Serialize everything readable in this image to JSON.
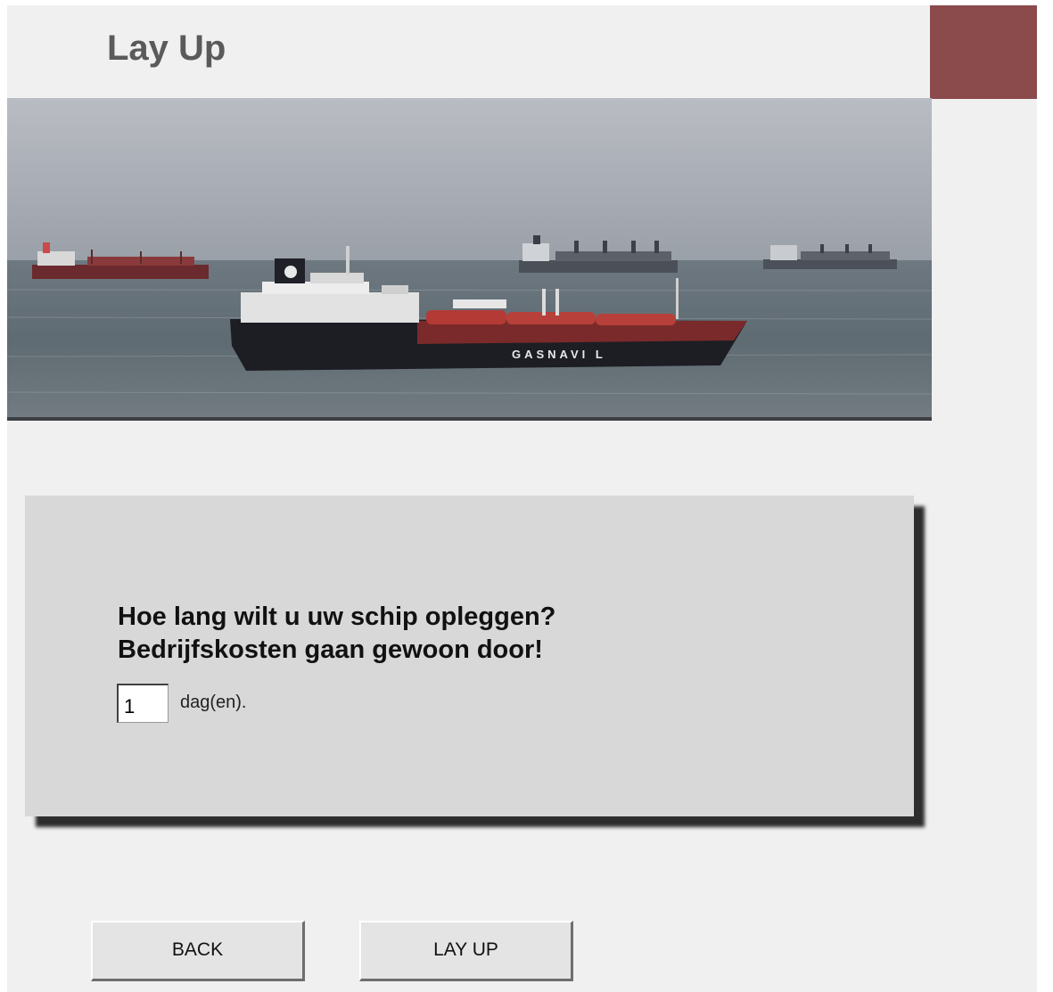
{
  "header": {
    "title": "Lay Up",
    "accent_color": "#8b4a4c"
  },
  "hero_image": {
    "ship_hull_text": "GASNAVI L",
    "description_icon": "ship-photo"
  },
  "form": {
    "question_line1": "Hoe lang wilt u uw schip opleggen?",
    "question_line2": "Bedrijfskosten gaan gewoon door!",
    "days_value": "1",
    "days_unit": "dag(en)."
  },
  "buttons": {
    "back_label": "BACK",
    "layup_label": "LAY UP"
  }
}
